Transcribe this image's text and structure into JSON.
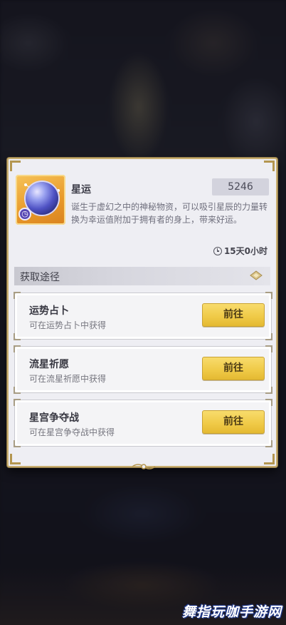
{
  "item": {
    "name": "星运",
    "count": "5246",
    "description": "诞生于虚幻之中的神秘物资，可以吸引星辰的力量转换为幸运值附加于拥有者的身上，带来好运。",
    "timer": "15天0小时"
  },
  "section": {
    "title": "获取途径"
  },
  "routes": [
    {
      "title": "运势占卜",
      "desc": "可在运势占卜中获得",
      "button": "前往"
    },
    {
      "title": "流星祈愿",
      "desc": "可在流星祈愿中获得",
      "button": "前往"
    },
    {
      "title": "星宫争夺战",
      "desc": "可在星宫争夺战中获得",
      "button": "前往"
    }
  ],
  "watermark": "舞指玩咖手游网",
  "colors": {
    "panel": "#eeeef3",
    "border_gold": "#c8ae70",
    "button_yellow": "#efc946",
    "icon_orange": "#e8992a"
  },
  "icons": {
    "item": "star-orb-icon",
    "badge": "clock-icon",
    "timer": "clock-icon",
    "section": "diamond-deco-icon"
  }
}
